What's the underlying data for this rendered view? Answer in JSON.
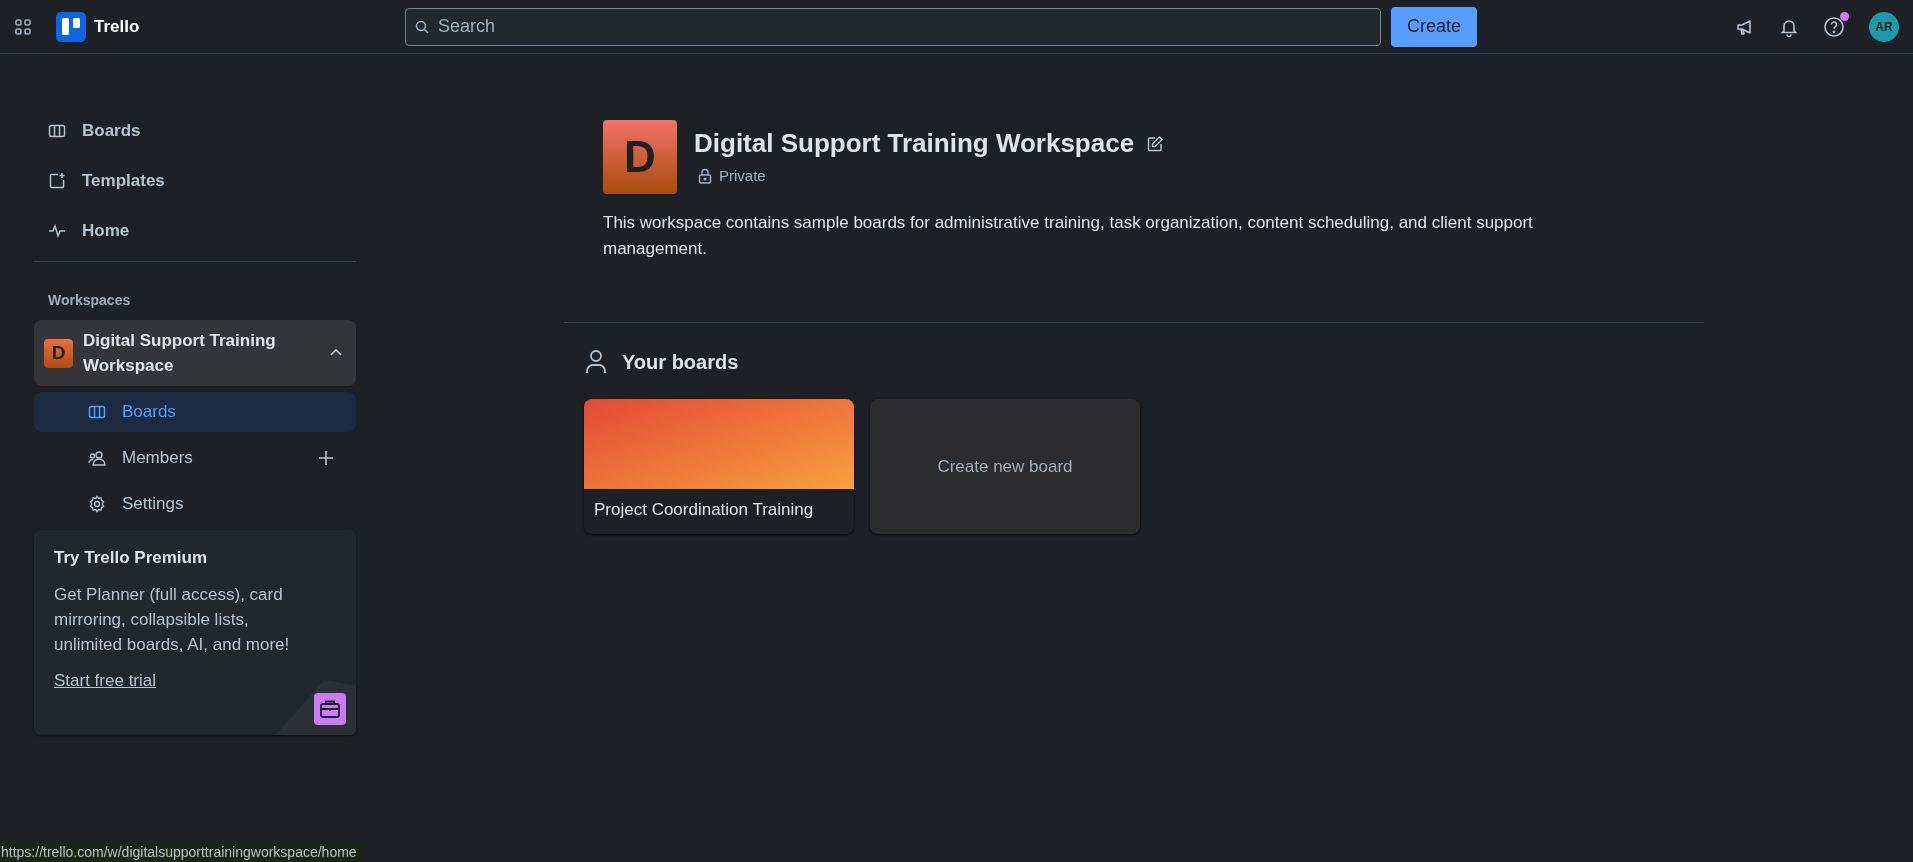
{
  "topbar": {
    "logo": "Trello",
    "search": {
      "placeholder": "Search"
    },
    "create_button": "Create",
    "help_notification": true,
    "avatar": "AR"
  },
  "sidebar": {
    "items": [
      {
        "label": "Boards",
        "kind": "boards",
        "selected": false
      },
      {
        "label": "Templates",
        "kind": "templates",
        "selected": false
      },
      {
        "label": "Home",
        "kind": "home",
        "selected": false
      }
    ],
    "workspaces_heading": "Workspaces",
    "workspace": {
      "letter": "D",
      "name": "Digital Support Training Workspace",
      "expanded": true,
      "children": [
        {
          "label": "Boards",
          "kind": "boards",
          "selected": true,
          "add": false
        },
        {
          "label": "Members",
          "kind": "members",
          "selected": false,
          "add": true
        },
        {
          "label": "Settings",
          "kind": "settings",
          "selected": false,
          "add": false
        }
      ]
    },
    "promo": {
      "title": "Try Trello Premium",
      "text": "Get Planner (full access), card mirroring, collapsible lists, unlimited boards, AI, and more!",
      "link": "Start free trial"
    }
  },
  "main": {
    "letter": "D",
    "title": "Digital Support Training Workspace",
    "visibility": "Private",
    "description": "This workspace contains sample boards for administrative training, task organization, content scheduling, and client support management.",
    "section_title": "Your boards",
    "boards": [
      {
        "kind": "board",
        "title": "Project Coordination Training"
      },
      {
        "kind": "create",
        "title": "Create new board"
      }
    ]
  },
  "status_bar": "https://trello.com/w/digitalsupporttrainingworkspace/home"
}
